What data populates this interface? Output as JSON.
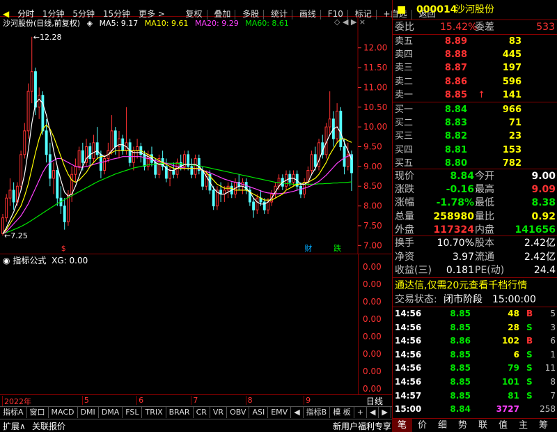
{
  "toolbar": {
    "tabs": [
      "分时",
      "1分钟",
      "5分钟",
      "15分钟",
      "更多 >"
    ],
    "buttons": [
      "复权",
      "叠加",
      "多股",
      "统计",
      "画线",
      "F10",
      "标记",
      "+自选",
      "返回"
    ]
  },
  "chart": {
    "title": "沙河股份(日线,前复权)",
    "ma": [
      {
        "label": "MA5: 9.17",
        "color": "#ffffff"
      },
      {
        "label": "MA10: 9.61",
        "color": "#ffff00"
      },
      {
        "label": "MA20: 9.29",
        "color": "#ff40ff"
      },
      {
        "label": "MA60: 8.61",
        "color": "#00e600"
      }
    ],
    "high_label": "12.28",
    "low_label": "7.25",
    "markers": [
      {
        "text": "$",
        "color": "#ff3232",
        "x": "2022-05-02"
      },
      {
        "text": "财",
        "color": "#00aaff",
        "x": "2022-08-26"
      },
      {
        "text": "跌",
        "color": "#00e600",
        "x": "2022-09-05"
      }
    ],
    "dates": [
      "2022年",
      "5",
      "6",
      "7",
      "8",
      "9"
    ],
    "period_label": "日线"
  },
  "indicator": {
    "label": "指标公式",
    "value": "XG: 0.00",
    "ticks": [
      "0.00",
      "0.00",
      "0.00",
      "0.00",
      "0.00",
      "0.00",
      "0.00",
      "0.00"
    ]
  },
  "bottombar": {
    "tabs": [
      "指标A",
      "窗口",
      "MACD",
      "DMI",
      "DMA",
      "FSL",
      "TRIX",
      "BRAR",
      "CR",
      "VR",
      "OBV",
      "ASI",
      "EMV"
    ],
    "right_tabs": [
      "指标B",
      "模 板"
    ],
    "arrows": [
      "+",
      "◀",
      "▶"
    ],
    "expand": "扩展∧",
    "related": "关联报价",
    "promo": "新用户福利专享"
  },
  "quote": {
    "code": "000014",
    "name": "沙河股份",
    "weibi_label": "委比",
    "weibi": "15.42%",
    "weicha_label": "委差",
    "weicha": "533",
    "asks": [
      {
        "label": "卖五",
        "price": "8.89",
        "vol": "83"
      },
      {
        "label": "卖四",
        "price": "8.88",
        "vol": "445"
      },
      {
        "label": "卖三",
        "price": "8.87",
        "vol": "197"
      },
      {
        "label": "卖二",
        "price": "8.86",
        "vol": "596"
      },
      {
        "label": "卖一",
        "price": "8.85",
        "vol": "141",
        "arrow": "↑"
      }
    ],
    "bids": [
      {
        "label": "买一",
        "price": "8.84",
        "vol": "966"
      },
      {
        "label": "买二",
        "price": "8.83",
        "vol": "71"
      },
      {
        "label": "买三",
        "price": "8.82",
        "vol": "23"
      },
      {
        "label": "买四",
        "price": "8.81",
        "vol": "153"
      },
      {
        "label": "买五",
        "price": "8.80",
        "vol": "782"
      }
    ],
    "stats": [
      {
        "l1": "现价",
        "v1": "8.84",
        "c1": "green",
        "l2": "今开",
        "v2": "9.00",
        "c2": "white"
      },
      {
        "l1": "涨跌",
        "v1": "-0.16",
        "c1": "green",
        "l2": "最高",
        "v2": "9.09",
        "c2": "red"
      },
      {
        "l1": "涨幅",
        "v1": "-1.78%",
        "c1": "green",
        "l2": "最低",
        "v2": "8.38",
        "c2": "green"
      },
      {
        "l1": "总量",
        "v1": "258980",
        "c1": "yellow",
        "l2": "量比",
        "v2": "0.92",
        "c2": "yellow"
      },
      {
        "l1": "外盘",
        "v1": "117324",
        "c1": "red",
        "l2": "内盘",
        "v2": "141656",
        "c2": "green"
      }
    ],
    "stats2": [
      {
        "l1": "换手",
        "v1": "10.70%",
        "l2": "股本",
        "v2": "2.42亿"
      },
      {
        "l1": "净资",
        "v1": "3.97",
        "l2": "流通",
        "v2": "2.42亿"
      },
      {
        "l1": "收益(三)",
        "v1": "0.181",
        "l2": "PE(动)",
        "v2": "24.4"
      }
    ],
    "promo": "通达信,仅需20元查看千档行情",
    "status_label": "交易状态:",
    "status": "闭市阶段",
    "status_time": "15:00:00",
    "ticks": [
      {
        "t": "14:56",
        "p": "8.85",
        "v": "48",
        "bs": "B",
        "n": "5",
        "vc": "yellow",
        "bc": "red"
      },
      {
        "t": "14:56",
        "p": "8.85",
        "v": "28",
        "bs": "S",
        "n": "3",
        "vc": "yellow",
        "bc": "green"
      },
      {
        "t": "14:56",
        "p": "8.86",
        "v": "102",
        "bs": "B",
        "n": "6",
        "vc": "yellow",
        "bc": "red"
      },
      {
        "t": "14:56",
        "p": "8.85",
        "v": "6",
        "bs": "S",
        "n": "1",
        "vc": "yellow",
        "bc": "green"
      },
      {
        "t": "14:56",
        "p": "8.85",
        "v": "79",
        "bs": "S",
        "n": "11",
        "vc": "green",
        "bc": "green"
      },
      {
        "t": "14:56",
        "p": "8.85",
        "v": "101",
        "bs": "S",
        "n": "8",
        "vc": "green",
        "bc": "green"
      },
      {
        "t": "14:57",
        "p": "8.85",
        "v": "81",
        "bs": "S",
        "n": "7",
        "vc": "green",
        "bc": "green"
      },
      {
        "t": "15:00",
        "p": "8.84",
        "v": "3727",
        "bs": "",
        "n": "258",
        "vc": "magenta",
        "bc": "white"
      }
    ]
  },
  "nav": [
    "笔",
    "价",
    "细",
    "势",
    "联",
    "值",
    "主",
    "筹"
  ],
  "chart_data": {
    "type": "candlestick",
    "title": "沙河股份(日线,前复权)",
    "ylim": [
      6.9,
      12.4
    ],
    "yticks": [
      7.0,
      7.5,
      8.0,
      8.5,
      9.0,
      9.5,
      10.0,
      10.5,
      11.0,
      11.5,
      12.0
    ],
    "x_month_labels": [
      "2022年",
      "5",
      "6",
      "7",
      "8",
      "9"
    ],
    "ma_last": {
      "MA5": 9.17,
      "MA10": 9.61,
      "MA20": 9.29,
      "MA60": 8.61
    },
    "extremes": {
      "high": 12.28,
      "low": 7.25
    },
    "candles": [
      [
        7.3,
        7.8,
        7.25,
        7.7
      ],
      [
        7.7,
        8.3,
        7.6,
        8.2
      ],
      [
        8.2,
        8.7,
        8.0,
        8.4
      ],
      [
        8.4,
        8.6,
        7.9,
        8.1
      ],
      [
        8.1,
        8.6,
        8.0,
        8.5
      ],
      [
        8.5,
        9.4,
        8.4,
        9.3
      ],
      [
        9.3,
        10.1,
        9.2,
        9.9
      ],
      [
        9.9,
        11.1,
        9.7,
        10.9
      ],
      [
        10.9,
        12.28,
        10.6,
        11.4
      ],
      [
        11.4,
        11.5,
        10.3,
        10.5
      ],
      [
        10.5,
        11.0,
        10.2,
        10.8
      ],
      [
        10.8,
        10.9,
        9.8,
        9.9
      ],
      [
        9.9,
        10.2,
        9.1,
        9.3
      ],
      [
        9.3,
        9.6,
        8.5,
        8.7
      ],
      [
        8.7,
        9.1,
        8.3,
        8.9
      ],
      [
        8.9,
        9.0,
        8.0,
        8.2
      ],
      [
        8.2,
        8.5,
        7.8,
        8.0
      ],
      [
        8.0,
        8.2,
        7.4,
        7.6
      ],
      [
        7.6,
        8.4,
        7.5,
        8.3
      ],
      [
        8.3,
        9.0,
        8.1,
        8.8
      ],
      [
        8.8,
        9.2,
        8.6,
        9.0
      ],
      [
        9.0,
        9.5,
        8.9,
        9.4
      ],
      [
        9.4,
        9.6,
        8.9,
        9.1
      ],
      [
        9.1,
        9.7,
        9.0,
        9.5
      ],
      [
        9.5,
        9.6,
        9.0,
        9.2
      ],
      [
        9.2,
        9.8,
        9.1,
        9.6
      ],
      [
        9.6,
        10.0,
        9.2,
        9.3
      ],
      [
        9.3,
        9.4,
        8.7,
        8.9
      ],
      [
        8.9,
        9.3,
        8.8,
        9.2
      ],
      [
        9.2,
        9.6,
        9.1,
        9.4
      ],
      [
        9.4,
        10.3,
        9.3,
        9.9
      ],
      [
        9.9,
        10.0,
        9.3,
        9.5
      ],
      [
        9.5,
        9.9,
        9.2,
        9.7
      ],
      [
        9.7,
        9.8,
        9.3,
        9.4
      ],
      [
        9.4,
        10.5,
        9.3,
        9.6
      ],
      [
        9.6,
        9.7,
        9.0,
        9.1
      ],
      [
        9.1,
        9.5,
        8.9,
        9.4
      ],
      [
        9.4,
        9.7,
        9.2,
        9.5
      ],
      [
        9.5,
        9.6,
        9.1,
        9.3
      ],
      [
        9.3,
        9.4,
        8.9,
        9.0
      ],
      [
        9.0,
        9.4,
        8.9,
        9.3
      ],
      [
        9.3,
        9.5,
        9.0,
        9.1
      ],
      [
        9.1,
        9.2,
        8.7,
        8.8
      ],
      [
        8.8,
        9.3,
        8.7,
        9.2
      ],
      [
        9.2,
        9.4,
        8.9,
        9.0
      ],
      [
        9.0,
        9.2,
        8.6,
        8.7
      ],
      [
        8.7,
        9.0,
        8.5,
        8.9
      ],
      [
        8.9,
        9.1,
        8.7,
        8.8
      ],
      [
        8.8,
        9.2,
        8.7,
        9.1
      ],
      [
        9.1,
        9.3,
        8.9,
        9.0
      ],
      [
        9.0,
        9.4,
        8.9,
        9.3
      ],
      [
        9.3,
        9.4,
        8.9,
        9.0
      ],
      [
        9.0,
        9.2,
        8.7,
        8.8
      ],
      [
        8.8,
        9.3,
        8.7,
        9.2
      ],
      [
        9.2,
        9.3,
        8.8,
        8.9
      ],
      [
        8.9,
        9.0,
        8.4,
        8.5
      ],
      [
        8.5,
        8.9,
        8.4,
        8.8
      ],
      [
        8.8,
        8.9,
        8.3,
        8.4
      ],
      [
        8.4,
        8.5,
        7.9,
        8.0
      ],
      [
        8.0,
        8.5,
        7.9,
        8.4
      ],
      [
        8.4,
        8.6,
        8.1,
        8.3
      ],
      [
        8.3,
        8.5,
        8.1,
        8.4
      ],
      [
        8.4,
        8.6,
        8.2,
        8.5
      ],
      [
        8.5,
        8.6,
        8.2,
        8.3
      ],
      [
        8.3,
        8.7,
        8.2,
        8.6
      ],
      [
        8.6,
        8.8,
        8.4,
        8.5
      ],
      [
        8.5,
        8.7,
        8.3,
        8.6
      ],
      [
        8.6,
        8.7,
        8.3,
        8.4
      ],
      [
        8.4,
        8.5,
        8.0,
        8.1
      ],
      [
        8.1,
        8.2,
        7.7,
        7.9
      ],
      [
        7.9,
        8.3,
        7.8,
        8.2
      ],
      [
        8.2,
        8.4,
        8.0,
        8.1
      ],
      [
        8.1,
        8.2,
        7.8,
        7.9
      ],
      [
        7.9,
        8.2,
        7.8,
        8.1
      ],
      [
        8.1,
        8.4,
        8.0,
        8.3
      ],
      [
        8.3,
        8.6,
        8.2,
        8.5
      ],
      [
        8.5,
        8.8,
        8.4,
        8.7
      ],
      [
        8.7,
        8.8,
        8.4,
        8.5
      ],
      [
        8.5,
        8.9,
        8.4,
        8.8
      ],
      [
        8.8,
        8.9,
        8.5,
        8.6
      ],
      [
        8.6,
        8.9,
        8.5,
        8.8
      ],
      [
        8.8,
        8.9,
        8.4,
        8.5
      ],
      [
        8.5,
        8.6,
        8.2,
        8.3
      ],
      [
        8.3,
        8.7,
        8.2,
        8.6
      ],
      [
        8.6,
        9.0,
        8.5,
        8.9
      ],
      [
        8.9,
        9.4,
        8.8,
        9.3
      ],
      [
        9.3,
        9.5,
        8.9,
        9.0
      ],
      [
        9.0,
        9.7,
        8.9,
        9.6
      ],
      [
        9.6,
        9.8,
        9.2,
        9.3
      ],
      [
        9.3,
        10.1,
        9.2,
        10.0
      ],
      [
        10.0,
        10.9,
        9.8,
        10.2
      ],
      [
        10.2,
        10.4,
        9.5,
        9.7
      ],
      [
        9.7,
        10.6,
        9.6,
        10.4
      ],
      [
        10.4,
        10.5,
        9.4,
        9.5
      ],
      [
        9.5,
        9.7,
        8.8,
        9.0
      ],
      [
        9.0,
        9.6,
        8.9,
        9.3
      ],
      [
        9.3,
        9.4,
        8.38,
        8.84
      ]
    ],
    "ma5": [
      7.3,
      7.45,
      7.65,
      7.85,
      8.1,
      8.4,
      8.8,
      9.4,
      10.1,
      10.6,
      10.7,
      10.6,
      10.3,
      9.9,
      9.4,
      9.0,
      8.65,
      8.35,
      8.25,
      8.3,
      8.5,
      8.75,
      9.0,
      9.2,
      9.3,
      9.35,
      9.4,
      9.3,
      9.25,
      9.3,
      9.4,
      9.5,
      9.55,
      9.55,
      9.5,
      9.4,
      9.35,
      9.35,
      9.35,
      9.3,
      9.25,
      9.2,
      9.1,
      9.05,
      9.05,
      8.95,
      8.9,
      8.9,
      8.95,
      9.0,
      9.05,
      9.05,
      9.05,
      9.05,
      9.0,
      8.9,
      8.75,
      8.6,
      8.45,
      8.35,
      8.3,
      8.3,
      8.35,
      8.4,
      8.45,
      8.5,
      8.5,
      8.45,
      8.35,
      8.2,
      8.1,
      8.05,
      8.05,
      8.1,
      8.2,
      8.35,
      8.5,
      8.6,
      8.65,
      8.7,
      8.7,
      8.65,
      8.55,
      8.55,
      8.6,
      8.8,
      8.95,
      9.15,
      9.4,
      9.6,
      9.8,
      9.95,
      10.0,
      9.85,
      9.6,
      9.4,
      9.17
    ],
    "ma10": [
      7.3,
      7.4,
      7.55,
      7.7,
      7.85,
      8.0,
      8.25,
      8.55,
      8.95,
      9.35,
      9.7,
      9.95,
      10.05,
      9.95,
      9.75,
      9.5,
      9.25,
      9.0,
      8.8,
      8.65,
      8.6,
      8.65,
      8.75,
      8.85,
      9.0,
      9.1,
      9.2,
      9.25,
      9.25,
      9.3,
      9.35,
      9.4,
      9.4,
      9.4,
      9.4,
      9.4,
      9.4,
      9.4,
      9.4,
      9.35,
      9.3,
      9.25,
      9.2,
      9.15,
      9.1,
      9.05,
      9.0,
      8.95,
      8.95,
      8.95,
      8.95,
      8.95,
      8.95,
      8.95,
      8.95,
      8.9,
      8.85,
      8.75,
      8.65,
      8.55,
      8.5,
      8.45,
      8.45,
      8.45,
      8.4,
      8.4,
      8.4,
      8.4,
      8.35,
      8.3,
      8.25,
      8.2,
      8.15,
      8.15,
      8.15,
      8.2,
      8.25,
      8.3,
      8.4,
      8.45,
      8.5,
      8.55,
      8.55,
      8.6,
      8.6,
      8.65,
      8.7,
      8.8,
      8.95,
      9.1,
      9.3,
      9.45,
      9.6,
      9.7,
      9.7,
      9.65,
      9.61
    ],
    "ma20": [
      7.3,
      7.35,
      7.45,
      7.55,
      7.65,
      7.75,
      7.9,
      8.05,
      8.25,
      8.45,
      8.65,
      8.85,
      9.0,
      9.1,
      9.15,
      9.2,
      9.2,
      9.15,
      9.1,
      9.05,
      9.0,
      8.98,
      8.98,
      9.0,
      9.02,
      9.05,
      9.08,
      9.1,
      9.12,
      9.15,
      9.18,
      9.2,
      9.22,
      9.25,
      9.25,
      9.25,
      9.25,
      9.25,
      9.25,
      9.22,
      9.2,
      9.18,
      9.15,
      9.12,
      9.1,
      9.08,
      9.05,
      9.02,
      9.0,
      8.98,
      8.96,
      8.95,
      8.95,
      8.95,
      8.93,
      8.9,
      8.87,
      8.84,
      8.8,
      8.76,
      8.72,
      8.68,
      8.65,
      8.62,
      8.6,
      8.58,
      8.55,
      8.52,
      8.48,
      8.45,
      8.42,
      8.38,
      8.35,
      8.33,
      8.32,
      8.31,
      8.31,
      8.32,
      8.33,
      8.35,
      8.37,
      8.4,
      8.42,
      8.45,
      8.48,
      8.52,
      8.57,
      8.62,
      8.7,
      8.78,
      8.88,
      8.98,
      9.08,
      9.15,
      9.22,
      9.26,
      9.29
    ],
    "ma60": [
      7.3,
      7.33,
      7.36,
      7.4,
      7.44,
      7.48,
      7.53,
      7.58,
      7.64,
      7.7,
      7.76,
      7.82,
      7.88,
      7.94,
      8.0,
      8.06,
      8.11,
      8.16,
      8.21,
      8.26,
      8.31,
      8.36,
      8.41,
      8.46,
      8.51,
      8.56,
      8.61,
      8.65,
      8.69,
      8.73,
      8.77,
      8.81,
      8.84,
      8.87,
      8.9,
      8.93,
      8.96,
      8.98,
      9.0,
      9.02,
      9.04,
      9.05,
      9.06,
      9.07,
      9.08,
      9.08,
      9.08,
      9.08,
      9.08,
      9.07,
      9.06,
      9.05,
      9.04,
      9.03,
      9.02,
      9.0,
      8.98,
      8.96,
      8.94,
      8.92,
      8.9,
      8.88,
      8.86,
      8.84,
      8.82,
      8.8,
      8.78,
      8.76,
      8.74,
      8.72,
      8.7,
      8.68,
      8.66,
      8.64,
      8.62,
      8.6,
      8.59,
      8.58,
      8.57,
      8.56,
      8.55,
      8.55,
      8.55,
      8.55,
      8.55,
      8.55,
      8.55,
      8.56,
      8.56,
      8.57,
      8.57,
      8.58,
      8.58,
      8.59,
      8.59,
      8.6,
      8.61
    ]
  }
}
